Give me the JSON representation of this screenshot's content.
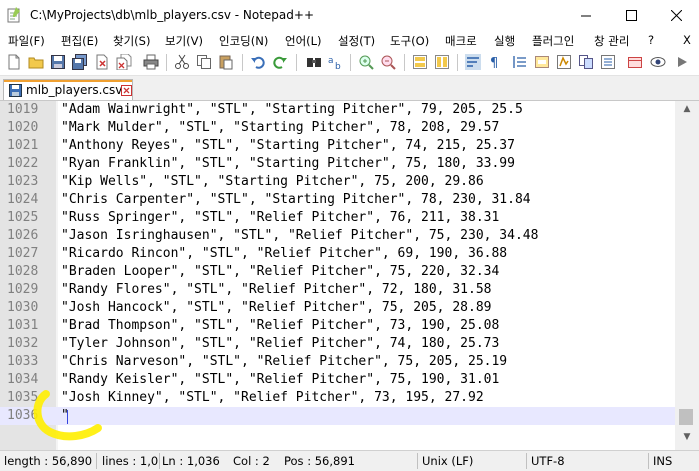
{
  "window": {
    "title": "C:\\MyProjects\\db\\mlb_players.csv - Notepad++"
  },
  "menu": [
    {
      "name": "menu-file",
      "label": "파일(F)"
    },
    {
      "name": "menu-edit",
      "label": "편집(E)"
    },
    {
      "name": "menu-search",
      "label": "찾기(S)"
    },
    {
      "name": "menu-view",
      "label": "보기(V)"
    },
    {
      "name": "menu-encoding",
      "label": "인코딩(N)"
    },
    {
      "name": "menu-language",
      "label": "언어(L)"
    },
    {
      "name": "menu-settings",
      "label": "설정(T)"
    },
    {
      "name": "menu-tools",
      "label": "도구(O)"
    },
    {
      "name": "menu-macro",
      "label": "매크로"
    },
    {
      "name": "menu-run",
      "label": "실행"
    },
    {
      "name": "menu-plugins",
      "label": "플러그인"
    },
    {
      "name": "menu-window",
      "label": "창 관리"
    },
    {
      "name": "menu-help",
      "label": "?"
    }
  ],
  "menu_close_label": "X",
  "tab": {
    "label": "mlb_players.csv"
  },
  "editor": {
    "lines": [
      {
        "num": "1019",
        "text": "\"Adam Wainwright\", \"STL\", \"Starting Pitcher\", 79, 205, 25.5"
      },
      {
        "num": "1020",
        "text": "\"Mark Mulder\", \"STL\", \"Starting Pitcher\", 78, 208, 29.57"
      },
      {
        "num": "1021",
        "text": "\"Anthony Reyes\", \"STL\", \"Starting Pitcher\", 74, 215, 25.37"
      },
      {
        "num": "1022",
        "text": "\"Ryan Franklin\", \"STL\", \"Starting Pitcher\", 75, 180, 33.99"
      },
      {
        "num": "1023",
        "text": "\"Kip Wells\", \"STL\", \"Starting Pitcher\", 75, 200, 29.86"
      },
      {
        "num": "1024",
        "text": "\"Chris Carpenter\", \"STL\", \"Starting Pitcher\", 78, 230, 31.84"
      },
      {
        "num": "1025",
        "text": "\"Russ Springer\", \"STL\", \"Relief Pitcher\", 76, 211, 38.31"
      },
      {
        "num": "1026",
        "text": "\"Jason Isringhausen\", \"STL\", \"Relief Pitcher\", 75, 230, 34.48"
      },
      {
        "num": "1027",
        "text": "\"Ricardo Rincon\", \"STL\", \"Relief Pitcher\", 69, 190, 36.88"
      },
      {
        "num": "1028",
        "text": "\"Braden Looper\", \"STL\", \"Relief Pitcher\", 75, 220, 32.34"
      },
      {
        "num": "1029",
        "text": "\"Randy Flores\", \"STL\", \"Relief Pitcher\", 72, 180, 31.58"
      },
      {
        "num": "1030",
        "text": "\"Josh Hancock\", \"STL\", \"Relief Pitcher\", 75, 205, 28.89"
      },
      {
        "num": "1031",
        "text": "\"Brad Thompson\", \"STL\", \"Relief Pitcher\", 73, 190, 25.08"
      },
      {
        "num": "1032",
        "text": "\"Tyler Johnson\", \"STL\", \"Relief Pitcher\", 74, 180, 25.73"
      },
      {
        "num": "1033",
        "text": "\"Chris Narveson\", \"STL\", \"Relief Pitcher\", 75, 205, 25.19"
      },
      {
        "num": "1034",
        "text": "\"Randy Keisler\", \"STL\", \"Relief Pitcher\", 75, 190, 31.01"
      },
      {
        "num": "1035",
        "text": "\"Josh Kinney\", \"STL\", \"Relief Pitcher\", 73, 195, 27.92"
      },
      {
        "num": "1036",
        "text": "\""
      }
    ]
  },
  "status": {
    "length": "length : 56,890",
    "lines": "lines : 1,0",
    "ln": "Ln : 1,036",
    "col": "Col : 2",
    "pos": "Pos : 56,891",
    "eol": "Unix (LF)",
    "encoding": "UTF-8",
    "mode": "INS"
  },
  "colors": {
    "current_line": "#e8e8ff",
    "gutter": "#e4e4e4",
    "tab_accent": "#f0a030",
    "annotation": "#ffee00"
  },
  "toolbar_icons": [
    "new-file-icon",
    "open-file-icon",
    "save-icon",
    "save-all-icon",
    "close-icon",
    "close-all-icon",
    "print-icon",
    "cut-icon",
    "copy-icon",
    "paste-icon",
    "undo-icon",
    "redo-icon",
    "find-icon",
    "replace-icon",
    "zoom-in-icon",
    "zoom-out-icon",
    "sync-vertical-icon",
    "sync-horizontal-icon",
    "word-wrap-icon",
    "show-all-chars-icon",
    "indent-guide-icon",
    "doc-map-icon",
    "function-list-icon",
    "folder-workspace-icon",
    "doc-list-icon",
    "record-macro-icon",
    "monitor-icon"
  ]
}
